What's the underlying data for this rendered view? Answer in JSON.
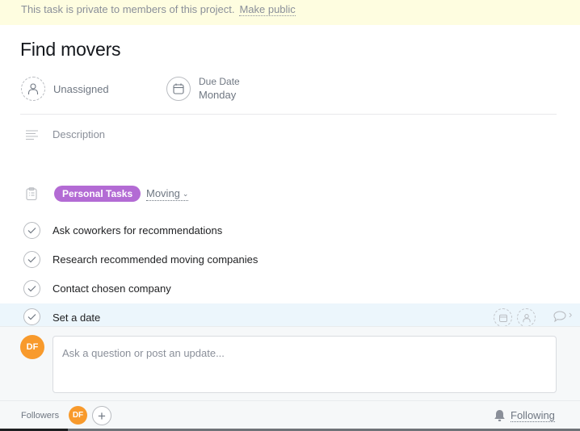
{
  "banner": {
    "message": "This task is private to members of this project.",
    "link": "Make public"
  },
  "task": {
    "title": "Find movers",
    "assignee": {
      "label": "Unassigned",
      "icon": "person-icon"
    },
    "due": {
      "label": "Due Date",
      "value": "Monday",
      "icon": "calendar-icon"
    },
    "description_placeholder": "Description",
    "project": {
      "tag": "Personal Tasks",
      "section": "Moving",
      "tag_color": "#b36bd4"
    }
  },
  "subtasks": [
    {
      "text": "Ask coworkers for recommendations"
    },
    {
      "text": "Research recommended moving companies"
    },
    {
      "text": "Contact chosen company"
    },
    {
      "text": "Set a date",
      "hovered": true
    }
  ],
  "comment": {
    "avatar_initials": "DF",
    "placeholder": "Ask a question or post an update...",
    "avatar_color": "#f89a2c"
  },
  "footer": {
    "followers_label": "Followers",
    "follower_initials": "DF",
    "add_follower": "+",
    "following_label": "Following"
  }
}
